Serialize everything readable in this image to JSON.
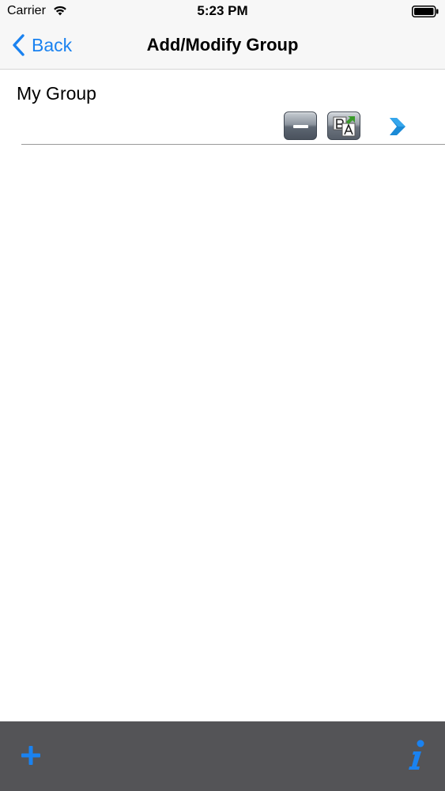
{
  "status_bar": {
    "carrier": "Carrier",
    "time": "5:23 PM"
  },
  "nav": {
    "back_label": "Back",
    "title": "Add/Modify Group"
  },
  "group": {
    "name": "My Group"
  },
  "colors": {
    "accent": "#1a82f0",
    "toolbar": "#545457",
    "nav_background": "#f7f7f7"
  },
  "icons": {
    "wifi": "wifi-icon",
    "battery": "battery-icon",
    "back": "back-chevron-icon",
    "remove": "minus-icon",
    "translate": "translate-icon",
    "next": "chevron-right-icon",
    "add": "plus-icon",
    "info": "info-icon"
  }
}
